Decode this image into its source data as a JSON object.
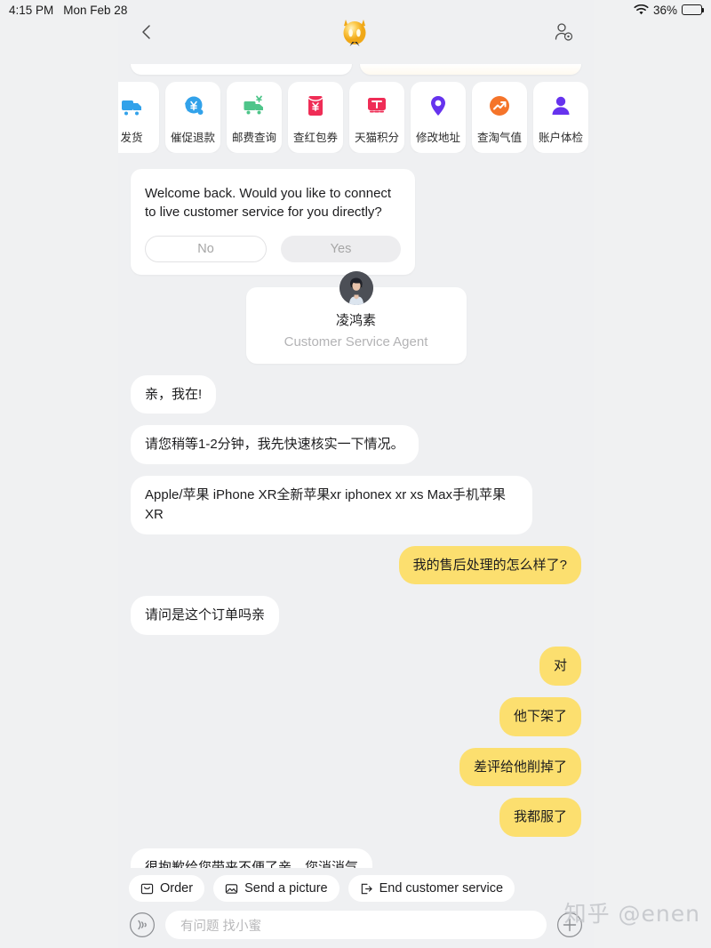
{
  "status_bar": {
    "time": "4:15 PM",
    "date": "Mon Feb 28",
    "battery_percent": "36%",
    "wifi_icon": "wifi-icon",
    "battery_icon": "battery-icon"
  },
  "header": {
    "back_icon": "back-chevron-icon",
    "logo_icon": "alime-bee-logo-icon",
    "profile_icon": "profile-settings-icon"
  },
  "quick_actions": [
    {
      "label": "发货",
      "icon": "truck-icon",
      "color": "#32a2ea"
    },
    {
      "label": "催促退款",
      "icon": "refund-yen-icon",
      "color": "#32a2ea"
    },
    {
      "label": "邮费查询",
      "icon": "shipping-fee-truck-icon",
      "color": "#4ec58a"
    },
    {
      "label": "查红包券",
      "icon": "red-packet-icon",
      "color": "#ef2d56"
    },
    {
      "label": "天猫积分",
      "icon": "tmall-points-icon",
      "color": "#ef2d56"
    },
    {
      "label": "修改地址",
      "icon": "location-pin-icon",
      "color": "#6633ee"
    },
    {
      "label": "查淘气值",
      "icon": "trend-arrow-icon",
      "color": "#f5742a"
    },
    {
      "label": "账户体检",
      "icon": "account-person-icon",
      "color": "#6633ee"
    }
  ],
  "welcome_card": {
    "text": "Welcome back. Would you like to connect to live customer service for you directly?",
    "no_label": "No",
    "yes_label": "Yes"
  },
  "agent_card": {
    "avatar_icon": "agent-avatar",
    "name": "凌鸿素",
    "role": "Customer Service Agent"
  },
  "messages": [
    {
      "side": "in",
      "text": "亲，我在!"
    },
    {
      "side": "in",
      "text": "请您稍等1-2分钟，我先快速核实一下情况。"
    },
    {
      "side": "in",
      "text": "Apple/苹果 iPhone XR全新苹果xr iphonex xr xs Max手机苹果XR"
    },
    {
      "side": "out",
      "text": "我的售后处理的怎么样了?"
    },
    {
      "side": "in",
      "text": "请问是这个订单吗亲"
    },
    {
      "side": "out",
      "text": "对"
    },
    {
      "side": "out",
      "text": "他下架了"
    },
    {
      "side": "out",
      "text": "差评给他削掉了"
    },
    {
      "side": "out",
      "text": "我都服了"
    },
    {
      "side": "in",
      "text": "很抱歉给您带来不便了亲，您消消气"
    }
  ],
  "action_chips": [
    {
      "label": "Order",
      "icon": "order-box-icon"
    },
    {
      "label": "Send a picture",
      "icon": "image-icon"
    },
    {
      "label": "End customer service",
      "icon": "exit-arrow-icon"
    }
  ],
  "input_bar": {
    "voice_icon": "voice-wave-icon",
    "placeholder": "有问题 找小蜜",
    "value": "",
    "plus_icon": "plus-circle-icon"
  },
  "watermark": {
    "text": "知乎 @enen"
  },
  "colors": {
    "outgoing_bubble": "#fcdf6f",
    "incoming_bubble": "#ffffff",
    "app_background": "#eff0f2"
  }
}
